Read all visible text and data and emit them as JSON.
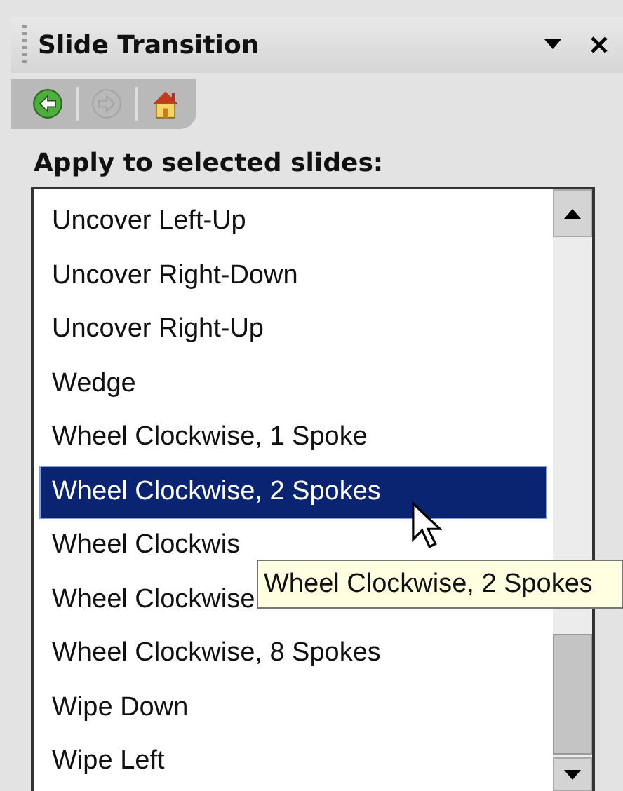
{
  "pane": {
    "title": "Slide Transition"
  },
  "toolbar": [
    {
      "kind": "back",
      "disabled": false
    },
    {
      "kind": "forward",
      "disabled": true
    },
    {
      "kind": "home",
      "disabled": false
    }
  ],
  "label": "Apply to selected slides:",
  "list": {
    "items": [
      {
        "text": "Uncover Left-Up",
        "selected": false
      },
      {
        "text": "Uncover Right-Down",
        "selected": false
      },
      {
        "text": "Uncover Right-Up",
        "selected": false
      },
      {
        "text": "Wedge",
        "selected": false
      },
      {
        "text": "Wheel Clockwise, 1 Spoke",
        "selected": false
      },
      {
        "text": "Wheel Clockwise, 2 Spokes",
        "selected": true
      },
      {
        "text": "Wheel Clockwis",
        "selected": false
      },
      {
        "text": "Wheel Clockwise",
        "selected": false
      },
      {
        "text": "Wheel Clockwise, 8 Spokes",
        "selected": false
      },
      {
        "text": "Wipe Down",
        "selected": false
      },
      {
        "text": "Wipe Left",
        "selected": false
      }
    ]
  },
  "tooltip": "Wheel Clockwise, 2 Spokes"
}
